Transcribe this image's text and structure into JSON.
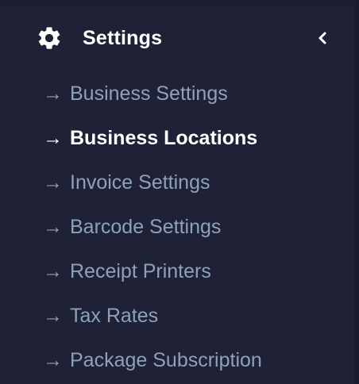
{
  "sidebar": {
    "section": {
      "title": "Settings",
      "icon": "gear-icon",
      "toggle_icon": "chevron-left-icon"
    },
    "arrow_glyph": "→",
    "items": [
      {
        "label": "Business Settings",
        "active": false
      },
      {
        "label": "Business Locations",
        "active": true
      },
      {
        "label": "Invoice Settings",
        "active": false
      },
      {
        "label": "Barcode Settings",
        "active": false
      },
      {
        "label": "Receipt Printers",
        "active": false
      },
      {
        "label": "Tax Rates",
        "active": false
      },
      {
        "label": "Package Subscription",
        "active": false
      }
    ]
  },
  "colors": {
    "background": "#1f2137",
    "inactive_text": "#8ea2b5",
    "active_text": "#ffffff"
  }
}
